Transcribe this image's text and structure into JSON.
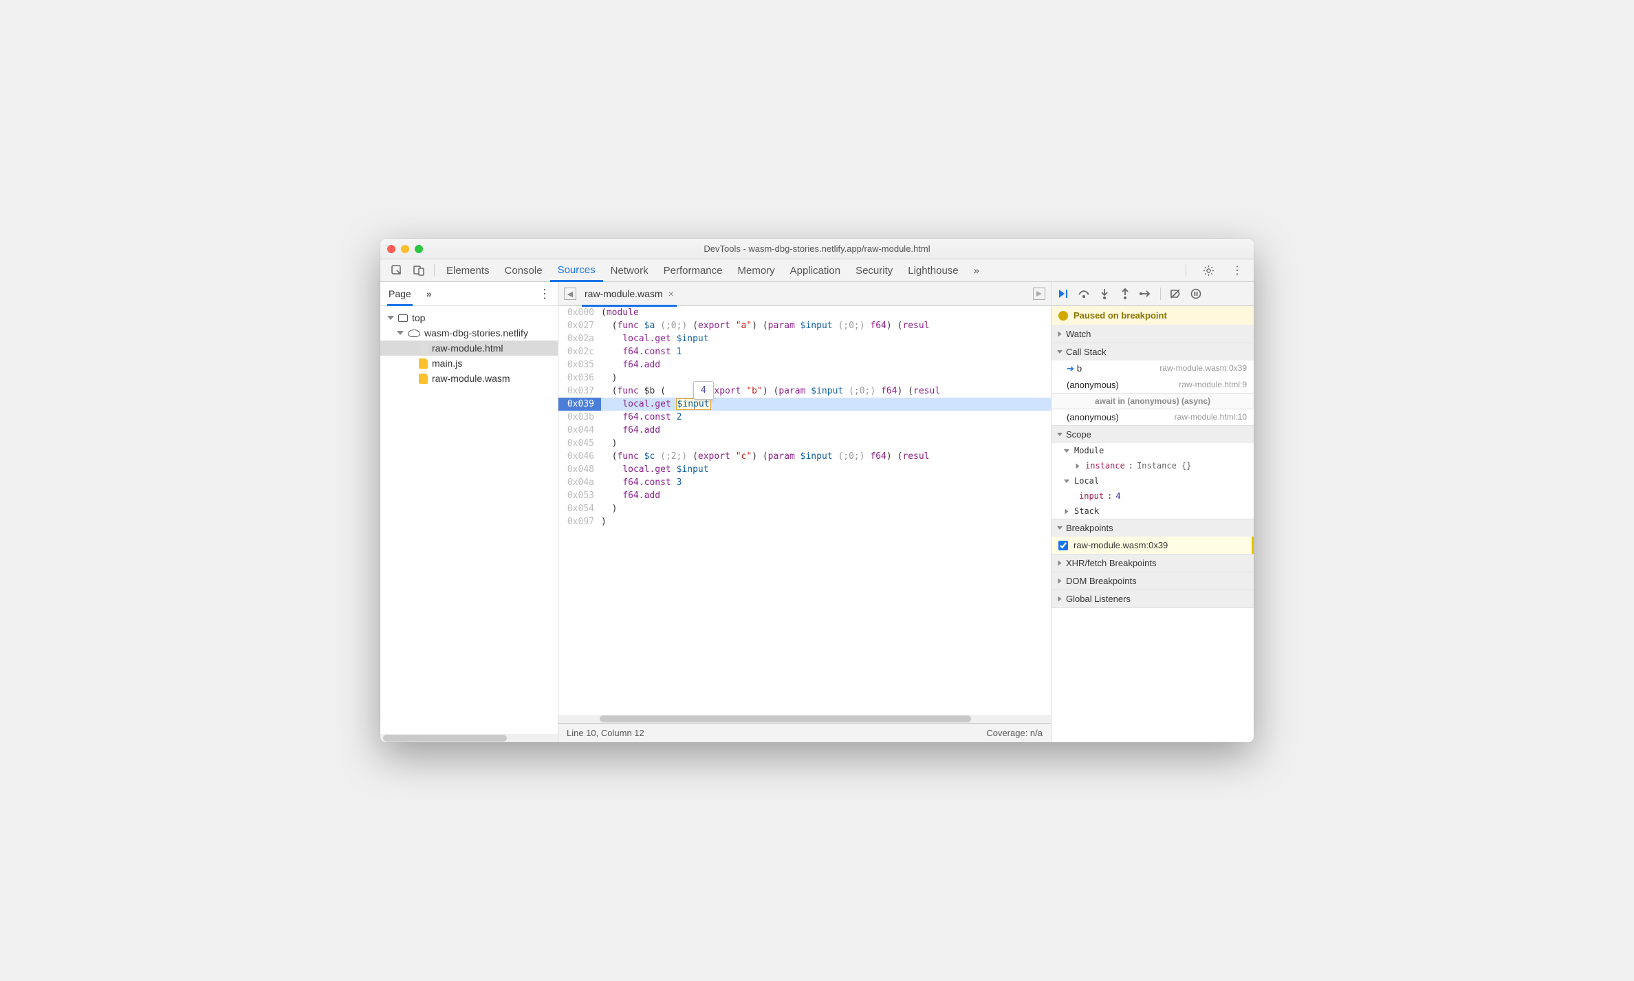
{
  "window_title": "DevTools - wasm-dbg-stories.netlify.app/raw-module.html",
  "toolbar": {
    "tabs": [
      "Elements",
      "Console",
      "Sources",
      "Network",
      "Performance",
      "Memory",
      "Application",
      "Security",
      "Lighthouse"
    ],
    "active": "Sources",
    "overflow": "»"
  },
  "nav": {
    "tab": "Page",
    "overflow": "»",
    "tree": {
      "top": "top",
      "origin": "wasm-dbg-stories.netlify",
      "files": [
        "raw-module.html",
        "main.js",
        "raw-module.wasm"
      ],
      "selected": "raw-module.html"
    }
  },
  "editor": {
    "tab": "raw-module.wasm",
    "hover_value": "4",
    "status_left": "Line 10, Column 12",
    "status_right": "Coverage: n/a",
    "current_offset": "0x039",
    "lines": [
      {
        "g": "0x000",
        "t": [
          "(",
          "module"
        ],
        "ty": [
          "p",
          "k"
        ]
      },
      {
        "g": "0x027",
        "t": [
          "  (",
          "func",
          " $a ",
          "(;0;)",
          " (",
          "export",
          " ",
          "\"a\"",
          ") (",
          "param",
          " $input ",
          "(;0;)",
          " ",
          "f64",
          ") (",
          "resul"
        ],
        "ty": [
          "p",
          "k",
          "v",
          "c",
          "p",
          "k",
          "p",
          "s",
          "p",
          "k",
          "v",
          "c",
          "p",
          "k",
          "p",
          "k"
        ]
      },
      {
        "g": "0x02a",
        "t": [
          "    ",
          "local.get",
          " $input"
        ],
        "ty": [
          "p",
          "k",
          "v"
        ]
      },
      {
        "g": "0x02c",
        "t": [
          "    ",
          "f64.const",
          " 1"
        ],
        "ty": [
          "p",
          "k",
          "n"
        ]
      },
      {
        "g": "0x035",
        "t": [
          "    ",
          "f64.add"
        ],
        "ty": [
          "p",
          "k"
        ]
      },
      {
        "g": "0x036",
        "t": [
          "  )"
        ],
        "ty": [
          "p"
        ]
      },
      {
        "g": "0x037",
        "t": [
          "  (",
          "func",
          " $b (     ) (",
          "export",
          " ",
          "\"b\"",
          ") (",
          "param",
          " $input ",
          "(;0;)",
          " ",
          "f64",
          ") (",
          "resul"
        ],
        "ty": [
          "p",
          "k",
          "p",
          "k",
          "p",
          "s",
          "p",
          "k",
          "v",
          "c",
          "p",
          "k",
          "p",
          "k"
        ]
      },
      {
        "g": "0x039",
        "t": [
          "    ",
          "local.get",
          " ",
          "$input"
        ],
        "ty": [
          "p",
          "k",
          "p",
          "hl"
        ],
        "cur": true
      },
      {
        "g": "0x03b",
        "t": [
          "    ",
          "f64.const",
          " 2"
        ],
        "ty": [
          "p",
          "k",
          "n"
        ]
      },
      {
        "g": "0x044",
        "t": [
          "    ",
          "f64.add"
        ],
        "ty": [
          "p",
          "k"
        ]
      },
      {
        "g": "0x045",
        "t": [
          "  )"
        ],
        "ty": [
          "p"
        ]
      },
      {
        "g": "0x046",
        "t": [
          "  (",
          "func",
          " $c ",
          "(;2;)",
          " (",
          "export",
          " ",
          "\"c\"",
          ") (",
          "param",
          " $input ",
          "(;0;)",
          " ",
          "f64",
          ") (",
          "resul"
        ],
        "ty": [
          "p",
          "k",
          "v",
          "c",
          "p",
          "k",
          "p",
          "s",
          "p",
          "k",
          "v",
          "c",
          "p",
          "k",
          "p",
          "k"
        ]
      },
      {
        "g": "0x048",
        "t": [
          "    ",
          "local.get",
          " $input"
        ],
        "ty": [
          "p",
          "k",
          "v"
        ]
      },
      {
        "g": "0x04a",
        "t": [
          "    ",
          "f64.const",
          " 3"
        ],
        "ty": [
          "p",
          "k",
          "n"
        ]
      },
      {
        "g": "0x053",
        "t": [
          "    ",
          "f64.add"
        ],
        "ty": [
          "p",
          "k"
        ]
      },
      {
        "g": "0x054",
        "t": [
          "  )"
        ],
        "ty": [
          "p"
        ]
      },
      {
        "g": "0x097",
        "t": [
          ")"
        ],
        "ty": [
          "p"
        ]
      }
    ]
  },
  "debugger": {
    "banner": "Paused on breakpoint",
    "sections": {
      "watch": "Watch",
      "callstack": "Call Stack",
      "scope": "Scope",
      "breakpoints": "Breakpoints",
      "xhr": "XHR/fetch Breakpoints",
      "dom": "DOM Breakpoints",
      "global": "Global Listeners"
    },
    "callstack": [
      {
        "name": "b",
        "loc": "raw-module.wasm:0x39",
        "current": true
      },
      {
        "name": "(anonymous)",
        "loc": "raw-module.html:9"
      },
      {
        "async": "await in (anonymous) (async)"
      },
      {
        "name": "(anonymous)",
        "loc": "raw-module.html:10"
      }
    ],
    "scope": {
      "module": {
        "label": "Module",
        "items": [
          {
            "name": "instance",
            "value": "Instance {}"
          }
        ]
      },
      "local": {
        "label": "Local",
        "items": [
          {
            "name": "input",
            "value": "4",
            "num": true
          }
        ]
      },
      "stack": {
        "label": "Stack"
      }
    },
    "breakpoints": [
      {
        "label": "raw-module.wasm:0x39",
        "checked": true
      }
    ]
  }
}
